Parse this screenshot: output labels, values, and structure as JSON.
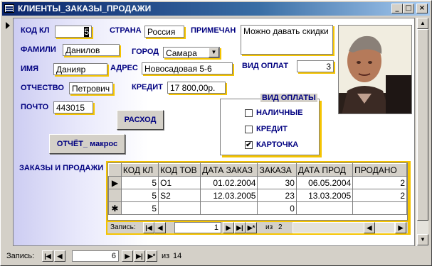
{
  "window": {
    "title": "КЛИЕНТЫ_ЗАКАЗЫ_ПРОДАЖИ"
  },
  "labels": {
    "kod": "КОД КЛ",
    "familiya": "ФАМИЛИ",
    "imya": "ИМЯ",
    "otchestvo": "ОТЧЕСТВО",
    "pochta": "ПОЧТО",
    "strana": "СТРАНА",
    "gorod": "ГОРОД",
    "adres": "АДРЕС",
    "kredit": "КРЕДИТ",
    "primechanie": "ПРИМЕЧАН",
    "vid_oplat": "ВИД ОПЛАТ",
    "zakazy": "ЗАКАЗЫ И ПРОДАЖИ"
  },
  "fields": {
    "kod": "5",
    "familiya": "Данилов",
    "imya": "Данияр",
    "otchestvo": "Петрович",
    "pochta": "443015",
    "strana": "Россия",
    "gorod": "Самара",
    "adres": "Новосадовая 5-6",
    "kredit": "17 800,00р.",
    "primechanie": "Можно давать скидки",
    "vid_oplat": "3"
  },
  "buttons": {
    "rashod": "РАСХОД",
    "otchet": "ОТЧЁТ_ макрос"
  },
  "payment_group": {
    "title": "ВИД ОПЛАТЫ",
    "options": [
      {
        "label": "НАЛИЧНЫЕ",
        "checked": false
      },
      {
        "label": "КРЕДИТ",
        "checked": false
      },
      {
        "label": "КАРТОЧКА",
        "checked": true
      }
    ]
  },
  "subform": {
    "columns": [
      "КОД КЛ",
      "КОД ТОВ",
      "ДАТА ЗАКАЗ",
      "ЗАКАЗА",
      "ДАТА ПРОД",
      "ПРОДАНО"
    ],
    "rows": [
      [
        "5",
        "O1",
        "01.02.2004",
        "30",
        "06.05.2004",
        "2"
      ],
      [
        "5",
        "S2",
        "12.03.2005",
        "23",
        "13.03.2005",
        "2"
      ],
      [
        "5",
        "",
        "",
        "0",
        "",
        ""
      ]
    ],
    "nav": {
      "label": "Запись:",
      "current": "1",
      "of": "из",
      "total": "2"
    }
  },
  "main_nav": {
    "label": "Запись:",
    "current": "6",
    "of": "из",
    "total": "14"
  },
  "colors": {
    "title_bar": "#0a246a",
    "accent": "#f5c400",
    "label": "#000080"
  }
}
